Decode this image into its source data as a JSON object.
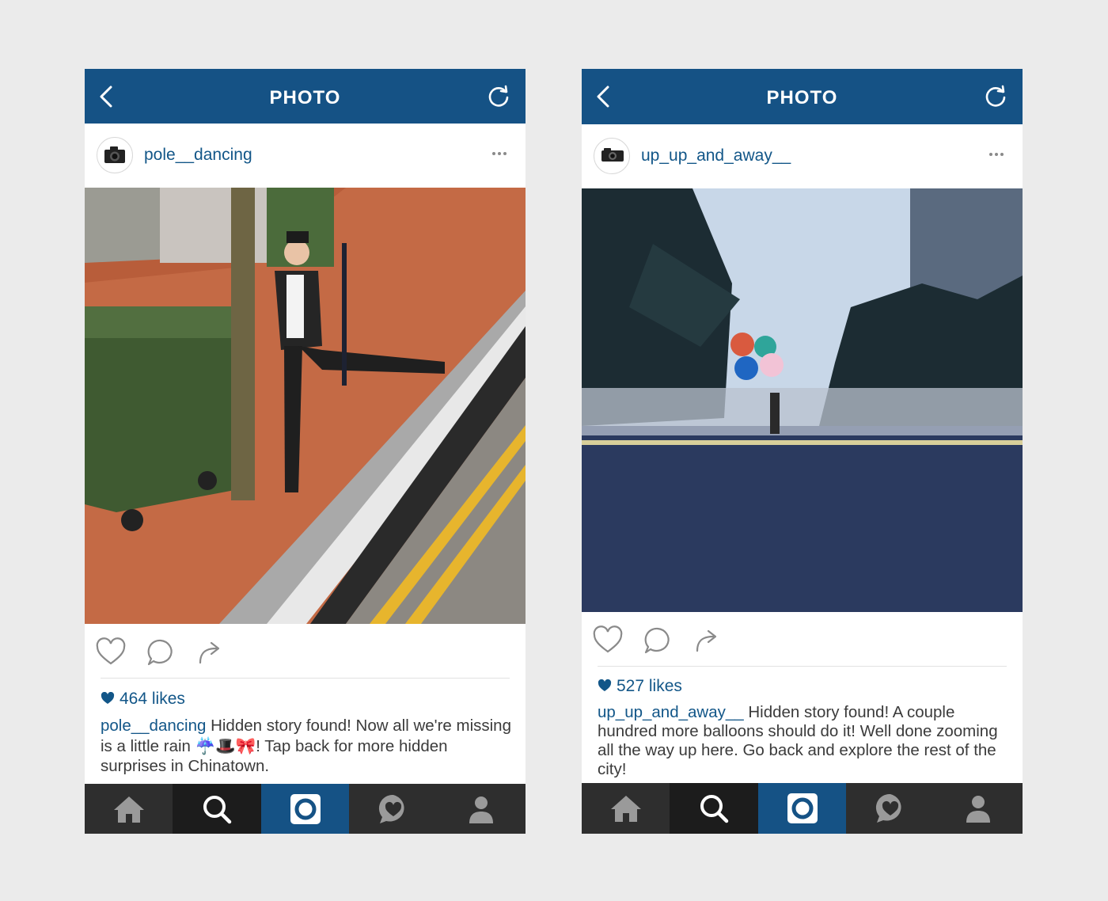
{
  "colors": {
    "accent": "#155285",
    "link": "#125688",
    "page_background": "#ebebeb",
    "tabbar": "#2e2e2e"
  },
  "screens": [
    {
      "nav": {
        "title": "PHOTO",
        "left_icon": "chevron-left-icon",
        "right_icon": "refresh-icon"
      },
      "post": {
        "username": "pole__dancing",
        "avatar_icon": "camera-icon",
        "more_icon": "ellipsis-icon",
        "photo_description_icon": "photo",
        "actions": [
          "heart-icon",
          "comment-icon",
          "share-icon"
        ],
        "likes": "464 likes",
        "caption_user": "pole__dancing",
        "caption_text": "Hidden story found! Now all we're missing is a little rain ☔🎩🎀! Tap back for more hidden surprises in Chinatown."
      },
      "tabs": [
        "home-icon",
        "search-icon",
        "camera-icon",
        "heart-bubble-icon",
        "profile-icon"
      ]
    },
    {
      "nav": {
        "title": "PHOTO",
        "left_icon": "chevron-left-icon",
        "right_icon": "refresh-icon"
      },
      "post": {
        "username": "up_up_and_away__",
        "avatar_icon": "camera-icon",
        "more_icon": "ellipsis-icon",
        "actions": [
          "heart-icon",
          "comment-icon",
          "share-icon"
        ],
        "likes": "527 likes",
        "caption_user": "up_up_and_away__",
        "caption_text": "Hidden story found! A couple hundred more balloons should do it! Well done zooming all the way up here. Go back and explore the rest of the city!"
      },
      "tabs": [
        "home-icon",
        "search-icon",
        "camera-icon",
        "heart-bubble-icon",
        "profile-icon"
      ]
    }
  ]
}
